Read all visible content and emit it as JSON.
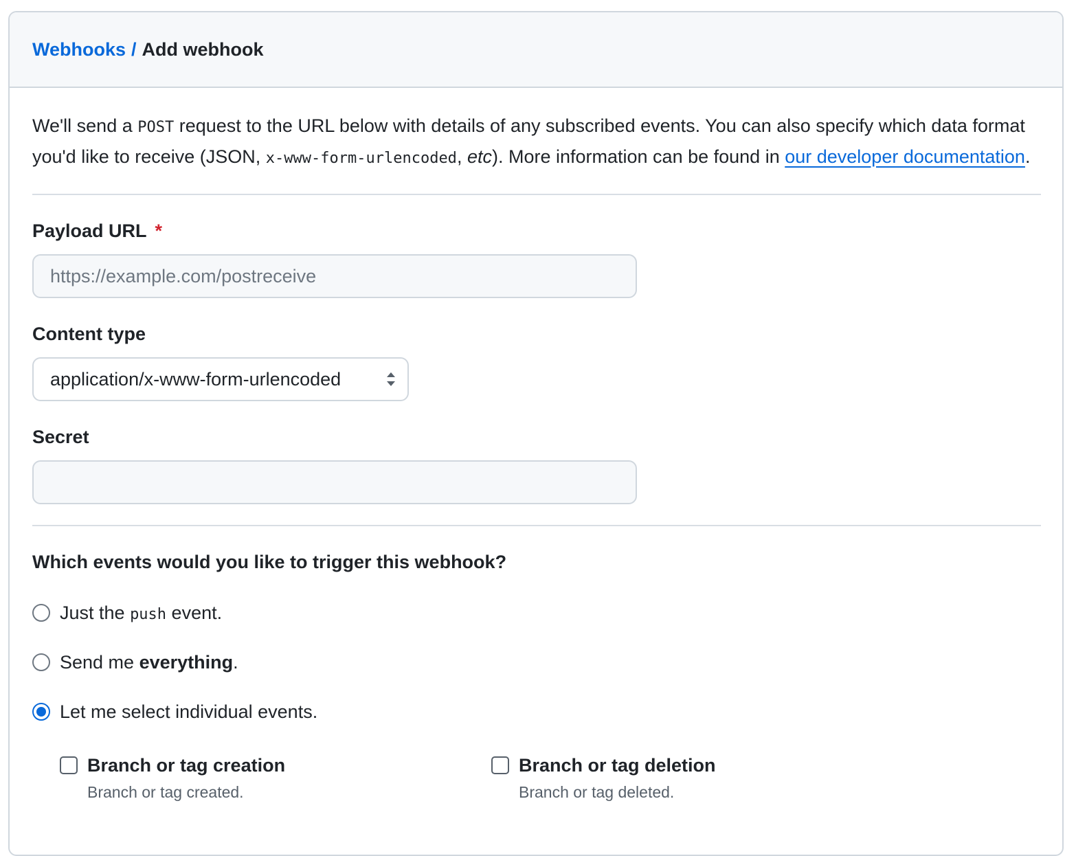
{
  "breadcrumb": {
    "parent": "Webhooks",
    "separator": "/",
    "current": "Add webhook"
  },
  "intro": {
    "part1": "We'll send a ",
    "code1": "POST",
    "part2": " request to the URL below with details of any subscribed events. You can also specify which data format you'd like to receive (JSON, ",
    "code2": "x-www-form-urlencoded",
    "part3": ", ",
    "etc": "etc",
    "part4": "). More information can be found in ",
    "link": "our developer documentation",
    "part5": "."
  },
  "payload_url": {
    "label": "Payload URL",
    "required_mark": "*",
    "placeholder": "https://example.com/postreceive",
    "value": ""
  },
  "content_type": {
    "label": "Content type",
    "selected": "application/x-www-form-urlencoded"
  },
  "secret": {
    "label": "Secret",
    "value": ""
  },
  "events_question": "Which events would you like to trigger this webhook?",
  "radio_options": {
    "push": {
      "before": "Just the ",
      "code": "push",
      "after": " event.",
      "checked": false
    },
    "everything": {
      "before": "Send me ",
      "bold": "everything",
      "after": ".",
      "checked": false
    },
    "individual": {
      "label": "Let me select individual events.",
      "checked": true
    }
  },
  "individual_events": [
    {
      "title": "Branch or tag creation",
      "description": "Branch or tag created.",
      "checked": false
    },
    {
      "title": "Branch or tag deletion",
      "description": "Branch or tag deleted.",
      "checked": false
    }
  ],
  "colors": {
    "link": "#0969da",
    "required": "#d1242f",
    "border": "#d0d7de",
    "header_bg": "#f6f8fa"
  }
}
